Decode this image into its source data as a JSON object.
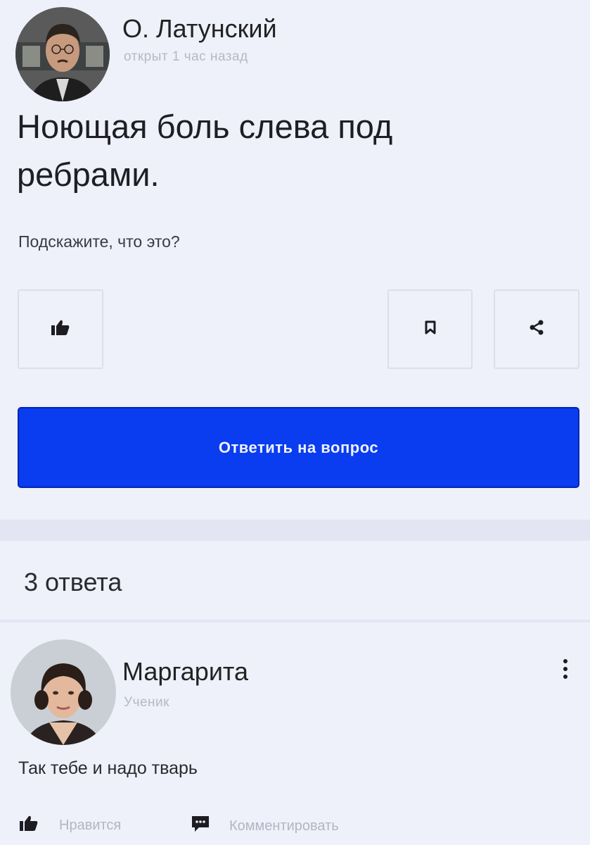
{
  "question": {
    "author": {
      "name": "О. Латунский",
      "meta": "открыт 1 час назад",
      "avatar_icon": "user-avatar-man"
    },
    "title": "Ноющая боль слева под ребрами.",
    "body": "Подскажите, что это?",
    "actions": {
      "like_icon": "thumbs-up-icon",
      "bookmark_icon": "bookmark-icon",
      "share_icon": "share-icon"
    },
    "answer_button_label": "Ответить на вопрос"
  },
  "answers": {
    "count_label": "3 ответа",
    "items": [
      {
        "author": "Маргарита",
        "role": "Ученик",
        "avatar_icon": "user-avatar-woman",
        "text": "Так тебе и надо тварь",
        "like_label": "Нравится",
        "comment_label": "Комментировать"
      }
    ]
  },
  "colors": {
    "background": "#eef0fa",
    "primary_button": "#0a3cf0",
    "muted_text": "#b6b8c6"
  }
}
